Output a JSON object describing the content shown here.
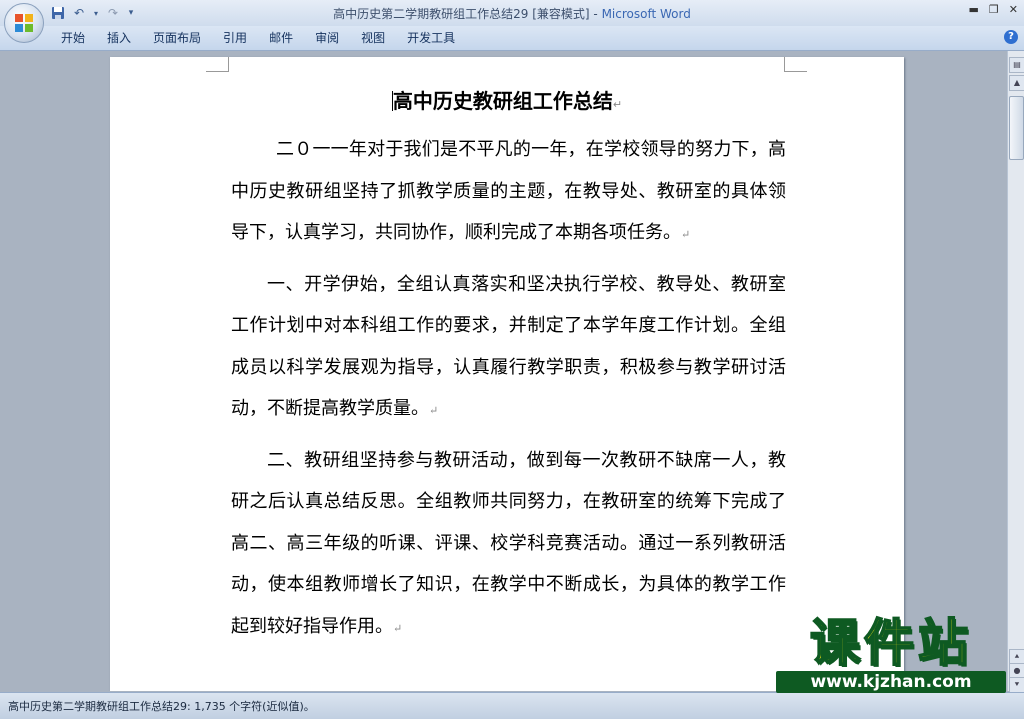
{
  "window": {
    "title_doc": "高中历史第二学期教研组工作总结29 [兼容模式]",
    "title_sep": " - ",
    "title_app": "Microsoft Word"
  },
  "qat": {
    "save_icon": "save-icon",
    "undo_icon": "undo-icon",
    "redo_icon": "redo-icon",
    "customize_icon": "dropdown-icon"
  },
  "tabs": [
    {
      "label": "开始"
    },
    {
      "label": "插入"
    },
    {
      "label": "页面布局"
    },
    {
      "label": "引用"
    },
    {
      "label": "邮件"
    },
    {
      "label": "审阅"
    },
    {
      "label": "视图"
    },
    {
      "label": "开发工具"
    }
  ],
  "document": {
    "title": "高中历史教研组工作总结",
    "paragraphs": [
      "二０一一年对于我们是不平凡的一年，在学校领导的努力下，高中历史教研组坚持了抓教学质量的主题，在教导处、教研室的具体领导下，认真学习，共同协作，顺利完成了本期各项任务。",
      "一、开学伊始，全组认真落实和坚决执行学校、教导处、教研室工作计划中对本科组工作的要求，并制定了本学年度工作计划。全组成员以科学发展观为指导，认真履行教学职责，积极参与教学研讨活动，不断提高教学质量。",
      "二、教研组坚持参与教研活动，做到每一次教研不缺席一人，教研之后认真总结反思。全组教师共同努力，在教研室的统筹下完成了高二、高三年级的听课、评课、校学科竞赛活动。通过一系列教研活动，使本组教师增长了知识，在教学中不断成长，为具体的教学工作起到较好指导作用。"
    ],
    "para_mark": "↵"
  },
  "watermark": {
    "name": "课件站",
    "url": "www.kjzhan.com"
  },
  "status": {
    "text": "高中历史第二学期教研组工作总结29: 1,735 个字符(近似值)。"
  },
  "colors": {
    "title_app": "#3a67b3",
    "watermark_fill": "#f7e616",
    "watermark_stroke": "#0e5a22"
  }
}
